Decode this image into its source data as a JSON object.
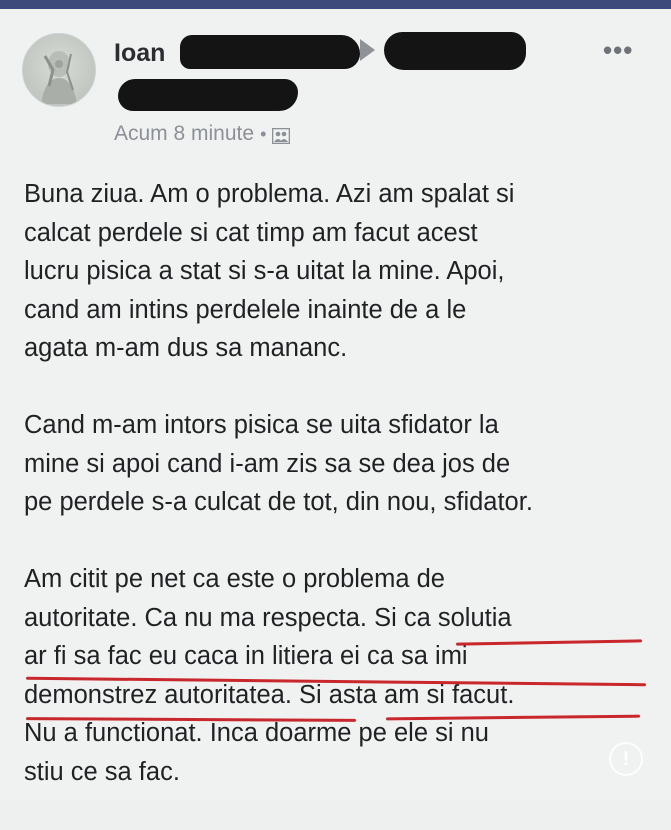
{
  "post": {
    "author_first_name": "Ioan",
    "timestamp": "Acum 8 minute",
    "timestamp_separator": "•",
    "privacy_icon": "friends-icon",
    "more_label": "•••",
    "paragraphs": [
      [
        "Buna ziua. Am o problema. Azi am spalat si",
        "calcat perdele si cat timp am facut acest",
        "lucru pisica a stat si s-a uitat la mine. Apoi,",
        "cand am intins perdelele inainte de a le",
        "agata m-am dus sa mananc."
      ],
      [
        "Cand m-am intors pisica se uita sfidator la",
        "mine si apoi cand i-am zis sa se dea jos de",
        "pe perdele s-a culcat de tot, din nou, sfidator."
      ],
      [
        "Am citit pe net ca este o problema de",
        "autoritate. Ca nu ma respecta. Si ca solutia",
        "ar fi  sa fac eu caca in litiera ei ca sa imi",
        "demonstrez autoritatea. Si asta am si facut.",
        "Nu a functionat. Inca doarme pe ele si nu",
        "stiu ce sa fac."
      ]
    ],
    "watermark_glyph": "!"
  },
  "colors": {
    "top_bar": "#3b4a7a",
    "underline": "#c8282c",
    "redaction": "#141414"
  }
}
